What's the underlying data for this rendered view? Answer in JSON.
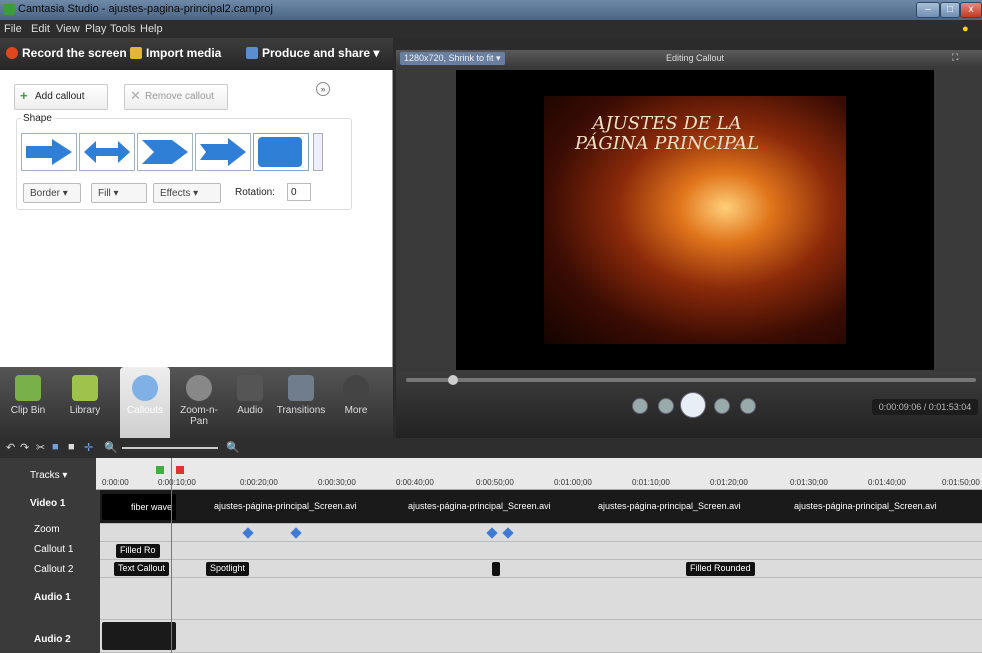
{
  "window": {
    "title": "Camtasia Studio - ajustes-pagina-principal2.camproj"
  },
  "menu": [
    "File",
    "Edit",
    "View",
    "Play",
    "Tools",
    "Help"
  ],
  "toolbar": {
    "record": "Record the screen ▾",
    "import": "Import media",
    "produce": "Produce and share ▾"
  },
  "callout_panel": {
    "add_label": "Add callout",
    "remove_label": "Remove callout",
    "shape_label": "Shape",
    "border_label": "Border ▾",
    "fill_label": "Fill ▾",
    "effects_label": "Effects ▾",
    "rotation_label": "Rotation:",
    "rotation_value": "0"
  },
  "preview": {
    "size_label": "1280x720, Shrink to fit ▾",
    "title": "Editing Callout",
    "video_caption_line1": "AJUSTES DE LA",
    "video_caption_line2": "PÁGINA PRINCIPAL",
    "timecode": "0:00:09:06 / 0:01:53:04"
  },
  "tasks": [
    {
      "label": "Clip Bin"
    },
    {
      "label": "Library"
    },
    {
      "label": "Callouts"
    },
    {
      "label": "Zoom-n-Pan"
    },
    {
      "label": "Audio"
    },
    {
      "label": "Transitions"
    },
    {
      "label": "More"
    }
  ],
  "timeline": {
    "tracks_label": "Tracks ▾",
    "ruler_ticks": [
      "0:00:00",
      "0:00:10;00",
      "0:00:20;00",
      "0:00:30;00",
      "0:00:40;00",
      "0:00:50;00",
      "0:01:00;00",
      "0:01:10;00",
      "0:01:20;00",
      "0:01:30;00",
      "0:01:40;00",
      "0:01:50;00"
    ],
    "track_names": [
      "Video 1",
      "Zoom",
      "Callout 1",
      "Callout 2",
      "Audio 1",
      "Audio 2"
    ],
    "video_clips": [
      "fiber wave",
      "ajustes-página-principal_Screen.avi",
      "ajustes-página-principal_Screen.avi",
      "ajustes-página-principal_Screen.avi",
      "ajustes-página-principal_Screen.avi"
    ],
    "callout1_clip": "Filled Ro",
    "callout2_clips": [
      "Text Callout",
      "Spotlight",
      "Filled Rounded"
    ]
  },
  "colors": {
    "record_dot": "#e0471e",
    "accent_blue": "#3f7bd6",
    "callout_tab": "#7fb0e6"
  }
}
